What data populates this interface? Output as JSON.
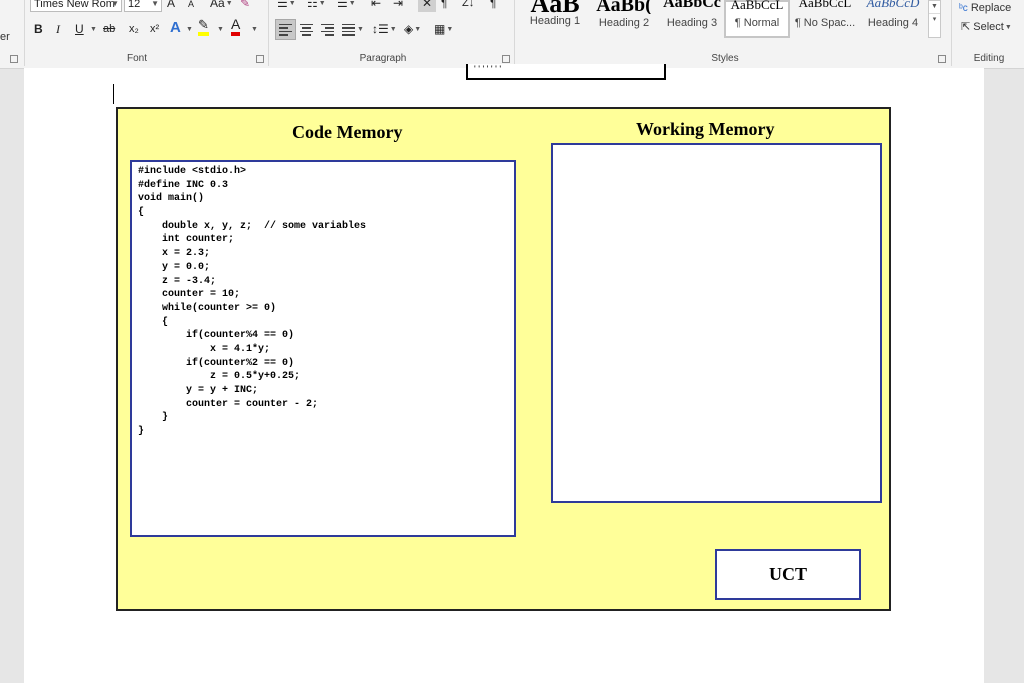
{
  "ribbon": {
    "partial_left_label": "er",
    "font_group": {
      "font_name": "Times New Rom",
      "font_size": "12",
      "grow_label": "A",
      "shrink_label": "A",
      "change_case_label": "Aa",
      "bold": "B",
      "italic": "I",
      "underline": "U",
      "strikethrough": "ab",
      "subscript": "x₂",
      "superscript": "x²",
      "text_effects": "A",
      "font_color": "A",
      "label": "Font"
    },
    "paragraph_group": {
      "sort_label": "Z↓",
      "pilcrow": "¶",
      "label": "Paragraph"
    },
    "styles_group": {
      "label": "Styles",
      "styles": [
        {
          "sample": "AaB",
          "name": "Heading 1"
        },
        {
          "sample": "AaBb(",
          "name": "Heading 2"
        },
        {
          "sample": "AaBbCc",
          "name": "Heading 3"
        },
        {
          "sample": "AaBbCcL",
          "name": "¶ Normal"
        },
        {
          "sample": "AaBbCcL",
          "name": "¶ No Spac..."
        },
        {
          "sample": "AaBbCcD",
          "name": "Heading 4"
        }
      ]
    },
    "editing_group": {
      "replace": "Replace",
      "select": "Select",
      "label": "Editing"
    }
  },
  "document": {
    "previous_box_text": "' ' ' ' ' ' '",
    "code_memory_title": "Code Memory",
    "working_memory_title": "Working Memory",
    "uct_label": "UCT",
    "code_lines": [
      "#include <stdio.h>",
      "#define INC 0.3",
      "void main()",
      "{",
      "    double x, y, z;  // some variables",
      "    int counter;",
      "    x = 2.3;",
      "    y = 0.0;",
      "    z = -3.4;",
      "    counter = 10;",
      "    while(counter >= 0)",
      "    {",
      "        if(counter%4 == 0)",
      "            x = 4.1*y;",
      "        if(counter%2 == 0)",
      "            z = 0.5*y+0.25;",
      "        y = y + INC;",
      "        counter = counter - 2;",
      "    }",
      "}"
    ],
    "colors": {
      "frame_fill": "#ffff99",
      "box_border": "#2e3a9a",
      "font_color_underline": "#e00000",
      "highlight_underline": "#ffff00",
      "text_effects_color": "#2f6fd0"
    }
  }
}
